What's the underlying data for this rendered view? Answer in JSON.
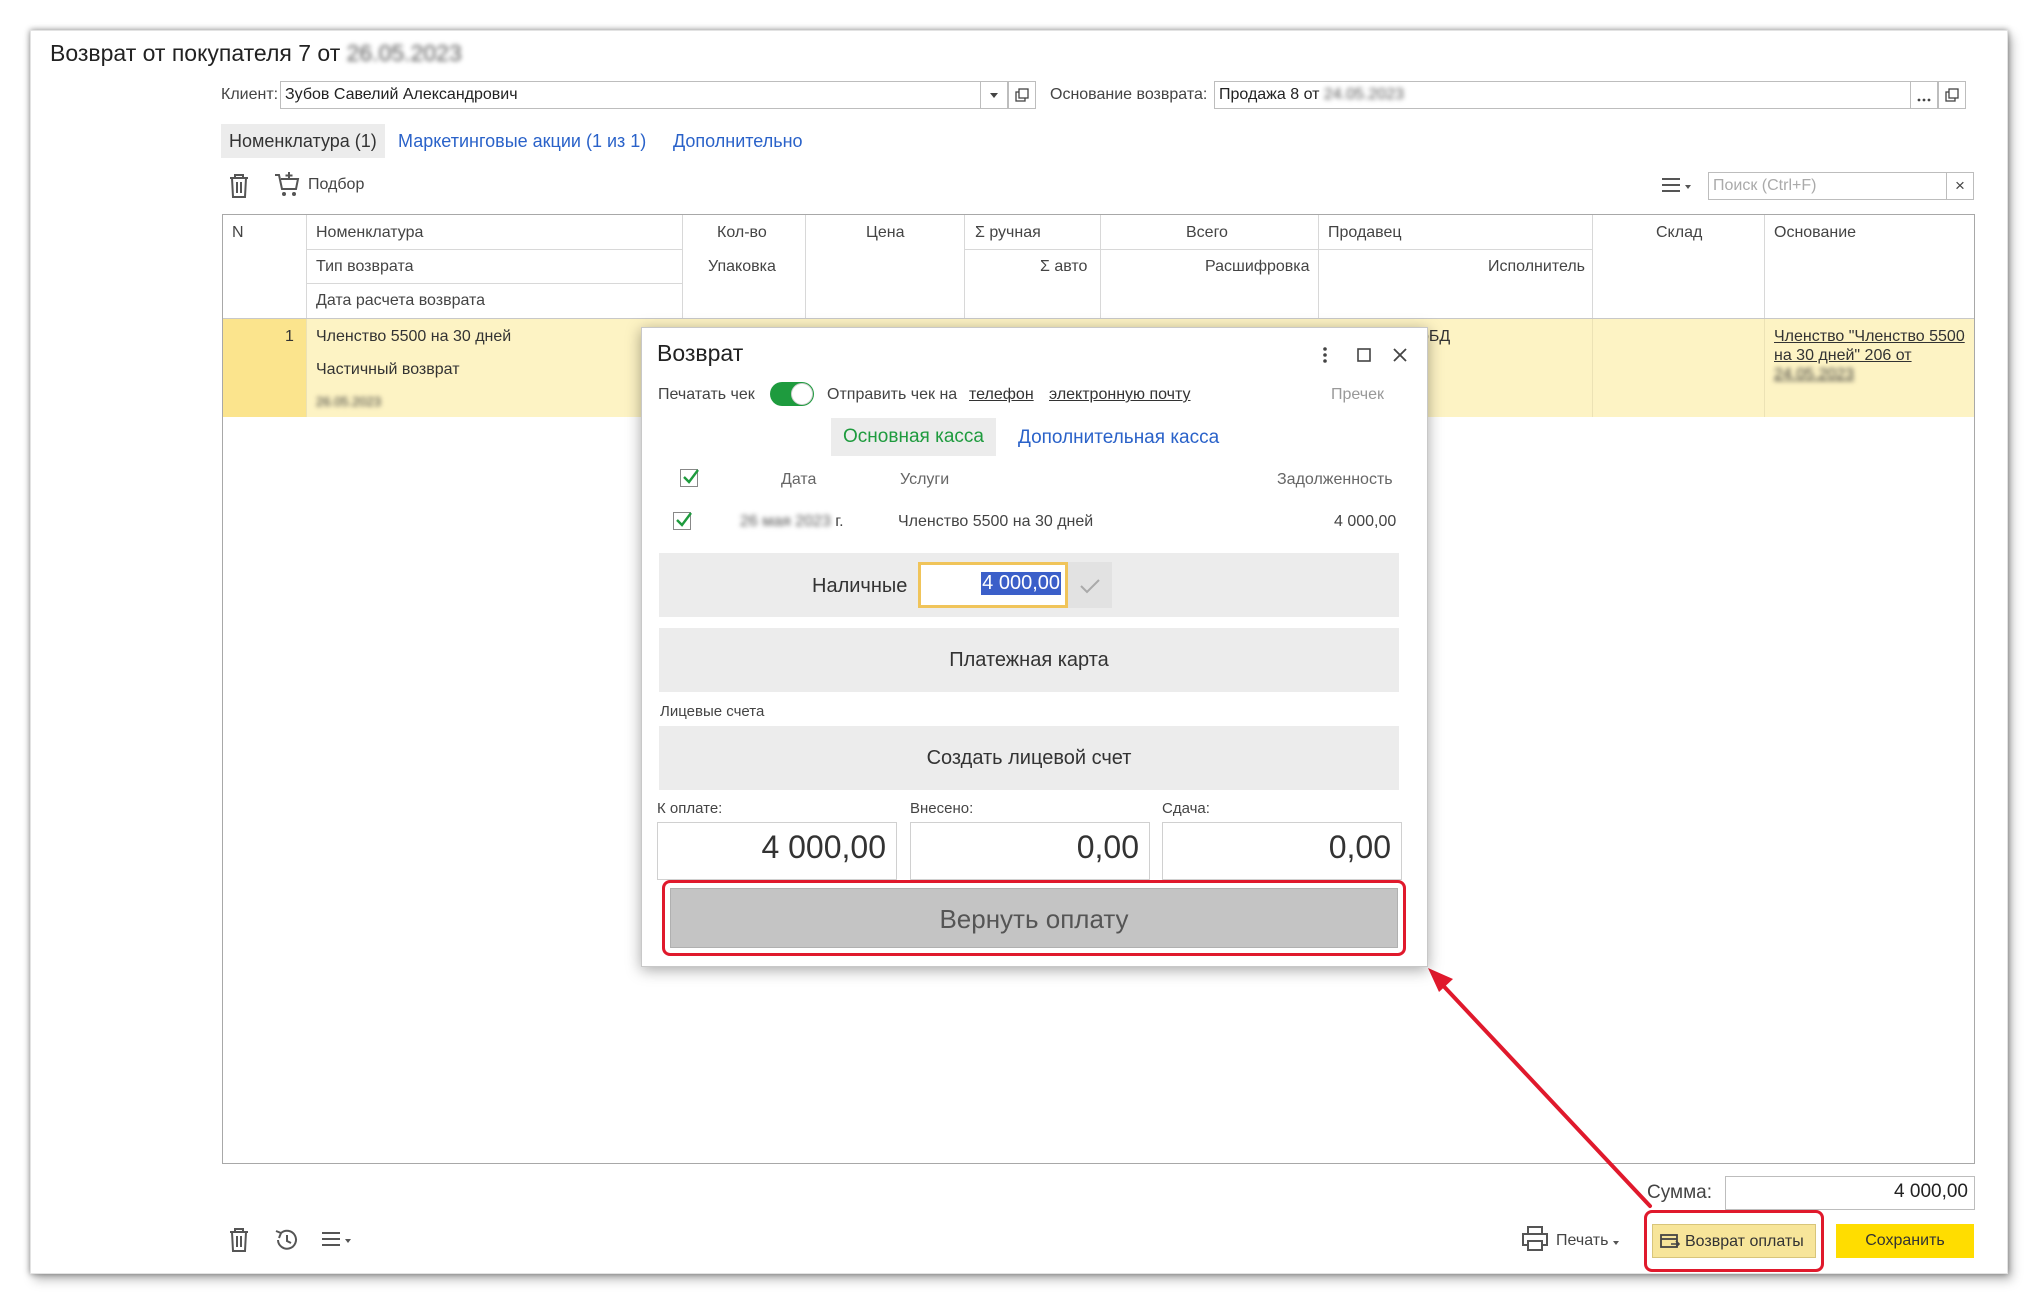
{
  "document": {
    "title": "Возврат от покупателя 7 от",
    "title_date": "26.05.2023",
    "client_label": "Клиент:",
    "client_value": "Зубов Савелий Александрович",
    "basis_label": "Основание возврата:",
    "basis_value": "Продажа 8 от",
    "basis_date": "24.05.2023"
  },
  "tabs": [
    {
      "label": "Номенклатура (1)",
      "active": true
    },
    {
      "label": "Маркетинговые акции (1 из 1)",
      "active": false
    },
    {
      "label": "Дополнительно",
      "active": false
    }
  ],
  "toolbar": {
    "pick_label": "Подбор",
    "search_placeholder": "Поиск (Ctrl+F)",
    "search_clear": "×"
  },
  "table": {
    "headers": {
      "n": "N",
      "nomenclature": "Номенклатура",
      "return_type": "Тип возврата",
      "return_calc_date": "Дата расчета возврата",
      "qty": "Кол-во",
      "pack": "Упаковка",
      "price": "Цена",
      "manual_sum": "Σ ручная",
      "auto_sum": "Σ авто",
      "total": "Всего",
      "breakdown": "Расшифровка",
      "seller": "Продавец",
      "executor": "Исполнитель",
      "warehouse": "Склад",
      "basis": "Основание"
    },
    "rows": [
      {
        "n": "1",
        "nomenclature": "Членство 5500 на 30 дней",
        "return_type": "Частичный возврат",
        "date": "26.05.2023",
        "seller_partial": "рБД",
        "basis_line1": "Членство \"Членство 5500",
        "basis_line2": "на 30 дней\" 206 от",
        "basis_date": "24.05.2023"
      }
    ]
  },
  "footer": {
    "sum_label": "Сумма:",
    "sum_value": "4 000,00",
    "print_label": "Печать",
    "refund_label": "Возврат оплаты",
    "save_label": "Сохранить"
  },
  "modal": {
    "title": "Возврат",
    "print_check_label": "Печатать чек",
    "print_check_on": true,
    "send_check_label": "Отправить чек на",
    "send_phone": "телефон",
    "send_email": "электронную почту",
    "precheck": "Пречек",
    "tab_main": "Основная касса",
    "tab_extra": "Дополнительная касса",
    "cols": {
      "date": "Дата",
      "services": "Услуги",
      "debt": "Задолженность"
    },
    "row": {
      "date": "26 мая 2023",
      "year_suffix": "г.",
      "service": "Членство 5500 на 30 дней",
      "debt": "4 000,00"
    },
    "cash_label": "Наличные",
    "cash_value": "4 000,00",
    "card_label": "Платежная карта",
    "accounts_label": "Лицевые счета",
    "create_account": "Создать лицевой счет",
    "to_pay_label": "К оплате:",
    "paid_label": "Внесено:",
    "change_label": "Сдача:",
    "to_pay": "4 000,00",
    "paid": "0,00",
    "change": "0,00",
    "refund_button": "Вернуть оплату"
  },
  "colors": {
    "accent_green": "#1e9b3e",
    "link_blue": "#2a62c9",
    "row_highlight": "#fdf3c4",
    "save_yellow": "#ffdd00",
    "annotation_red": "#e0192c"
  }
}
